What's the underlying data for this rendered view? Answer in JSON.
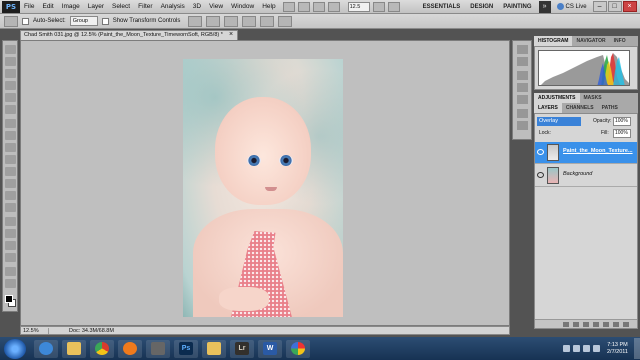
{
  "app": {
    "logo": "PS",
    "menu": [
      "File",
      "Edit",
      "Image",
      "Layer",
      "Select",
      "Filter",
      "Analysis",
      "3D",
      "View",
      "Window",
      "Help"
    ],
    "zoom_value": "12.5",
    "workspaces": [
      "ESSENTIALS",
      "DESIGN",
      "PAINTING"
    ],
    "more_label": "»",
    "cslive_label": "CS Live",
    "window_controls": [
      "–",
      "□",
      "×"
    ]
  },
  "options_bar": {
    "auto_select_label": "Auto-Select:",
    "auto_select_value": "Group",
    "transform_label": "Show Transform Controls"
  },
  "document": {
    "tab_title": "Chad Smith 031.jpg @ 12.5% (Paint_the_Moon_Texture_TimewornSoft, RGB/8) *",
    "close_label": "×",
    "status_zoom": "12.5%",
    "status_docs": "Doc: 34.3M/68.8M"
  },
  "panels": {
    "histogram_tabs": [
      "HISTOGRAM",
      "NAVIGATOR",
      "INFO"
    ],
    "adjust_tabs": [
      "ADJUSTMENTS",
      "MASKS"
    ],
    "layers_tabs": [
      "LAYERS",
      "CHANNELS",
      "PATHS"
    ],
    "blend_mode": "Overlay",
    "opacity_label": "Opacity:",
    "opacity_value": "100%",
    "lock_label": "Lock:",
    "fill_label": "Fill:",
    "fill_value": "100%",
    "layers": [
      {
        "name": "Paint_the_Moon_Texture..."
      },
      {
        "name": "Background"
      }
    ]
  },
  "taskbar": {
    "ps_label": "Ps",
    "lr_label": "Lr",
    "word_label": "W",
    "time": "7:13 PM",
    "date": "2/7/2011"
  }
}
